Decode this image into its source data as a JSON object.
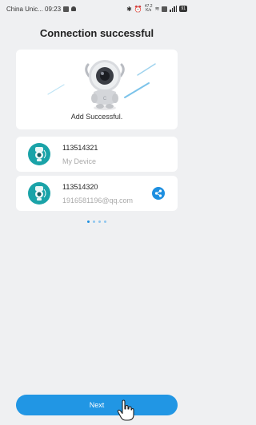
{
  "status_bar": {
    "carrier_time": "China Unic... 09:23",
    "speed_top": "47.2",
    "speed_unit": "K/s",
    "battery": "91"
  },
  "header": {
    "title": "Connection successful"
  },
  "success": {
    "message": "Add Successful."
  },
  "devices": [
    {
      "id": "113514321",
      "subtitle": "My Device",
      "shared": false
    },
    {
      "id": "113514320",
      "subtitle": "1916581196@qq.com",
      "shared": true
    }
  ],
  "pager": {
    "count": 4,
    "active_index": 0
  },
  "footer": {
    "next_label": "Next"
  },
  "colors": {
    "accent": "#2196e4",
    "device_teal": "#1aa3a8",
    "background": "#eff0f2"
  },
  "icons": [
    "robot-camera-icon",
    "device-camera-icon",
    "share-icon",
    "hand-cursor-icon"
  ]
}
